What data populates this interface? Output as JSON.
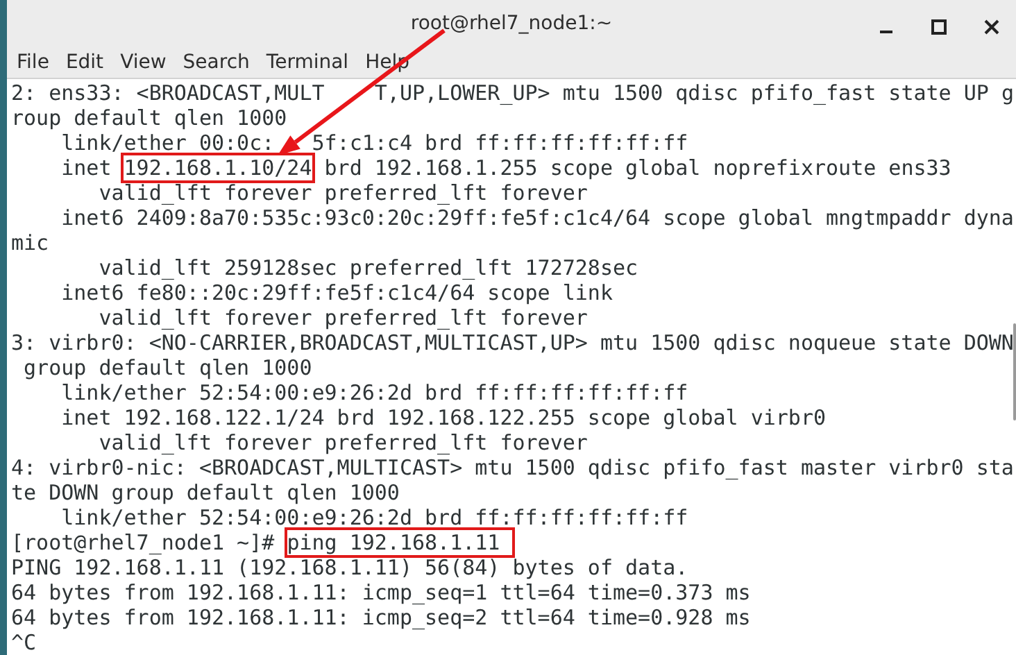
{
  "window": {
    "title": "root@rhel7_node1:~"
  },
  "menu": [
    "File",
    "Edit",
    "View",
    "Search",
    "Terminal",
    "Help"
  ],
  "terminal": {
    "lines": [
      {
        "parts": [
          {
            "text": "2: ens33: <BROADCAST,MULT",
            "boxed": false
          },
          {
            "text": "    T,UP,LOWER_UP> mtu 1500 qdisc pfifo_fast state UP g",
            "boxed": false
          }
        ]
      },
      {
        "parts": [
          {
            "text": "roup default qlen 1000",
            "boxed": false
          }
        ]
      },
      {
        "parts": [
          {
            "text": "    link/ether 00:0c:",
            "boxed": false
          },
          {
            "text": "   5f:c1:c4 brd ff:ff:ff:ff:ff:ff",
            "boxed": false
          }
        ]
      },
      {
        "parts": [
          {
            "text": "    inet ",
            "boxed": false
          },
          {
            "text": "192.168.1.10/24",
            "boxed": true
          },
          {
            "text": " brd 192.168.1.255 scope global noprefixroute ens33",
            "boxed": false
          }
        ]
      },
      {
        "parts": [
          {
            "text": "       valid_lft forever preferred_lft forever",
            "boxed": false
          }
        ]
      },
      {
        "parts": [
          {
            "text": "    inet6 2409:8a70:535c:93c0:20c:29ff:fe5f:c1c4/64 scope global mngtmpaddr dyna",
            "boxed": false
          }
        ]
      },
      {
        "parts": [
          {
            "text": "mic",
            "boxed": false
          }
        ]
      },
      {
        "parts": [
          {
            "text": "       valid_lft 259128sec preferred_lft 172728sec",
            "boxed": false
          }
        ]
      },
      {
        "parts": [
          {
            "text": "    inet6 fe80::20c:29ff:fe5f:c1c4/64 scope link",
            "boxed": false
          }
        ]
      },
      {
        "parts": [
          {
            "text": "       valid_lft forever preferred_lft forever",
            "boxed": false
          }
        ]
      },
      {
        "parts": [
          {
            "text": "3: virbr0: <NO-CARRIER,BROADCAST,MULTICAST,UP> mtu 1500 qdisc noqueue state DOWN",
            "boxed": false
          }
        ]
      },
      {
        "parts": [
          {
            "text": " group default qlen 1000",
            "boxed": false
          }
        ]
      },
      {
        "parts": [
          {
            "text": "    link/ether 52:54:00:e9:26:2d brd ff:ff:ff:ff:ff:ff",
            "boxed": false
          }
        ]
      },
      {
        "parts": [
          {
            "text": "    inet 192.168.122.1/24 brd 192.168.122.255 scope global virbr0",
            "boxed": false
          }
        ]
      },
      {
        "parts": [
          {
            "text": "       valid_lft forever preferred_lft forever",
            "boxed": false
          }
        ]
      },
      {
        "parts": [
          {
            "text": "4: virbr0-nic: <BROADCAST,MULTICAST> mtu 1500 qdisc pfifo_fast master virbr0 sta",
            "boxed": false
          }
        ]
      },
      {
        "parts": [
          {
            "text": "te DOWN group default qlen 1000",
            "boxed": false
          }
        ]
      },
      {
        "parts": [
          {
            "text": "    link/ether 52:54:00:e9:26:2d brd ff:ff:ff:ff:ff:ff",
            "boxed": false
          }
        ]
      },
      {
        "parts": [
          {
            "text": "[root@rhel7_node1 ~]# ",
            "boxed": false
          },
          {
            "text": "ping 192.168.1.11 ",
            "boxed": true
          }
        ]
      },
      {
        "parts": [
          {
            "text": "PING 192.168.1.11 (192.168.1.11) 56(84) bytes of data.",
            "boxed": false
          }
        ]
      },
      {
        "parts": [
          {
            "text": "64 bytes from 192.168.1.11: icmp_seq=1 ttl=64 time=0.373 ms",
            "boxed": false
          }
        ]
      },
      {
        "parts": [
          {
            "text": "64 bytes from 192.168.1.11: icmp_seq=2 ttl=64 time=0.928 ms",
            "boxed": false
          }
        ]
      },
      {
        "parts": [
          {
            "text": "^C",
            "boxed": false
          }
        ]
      }
    ]
  }
}
